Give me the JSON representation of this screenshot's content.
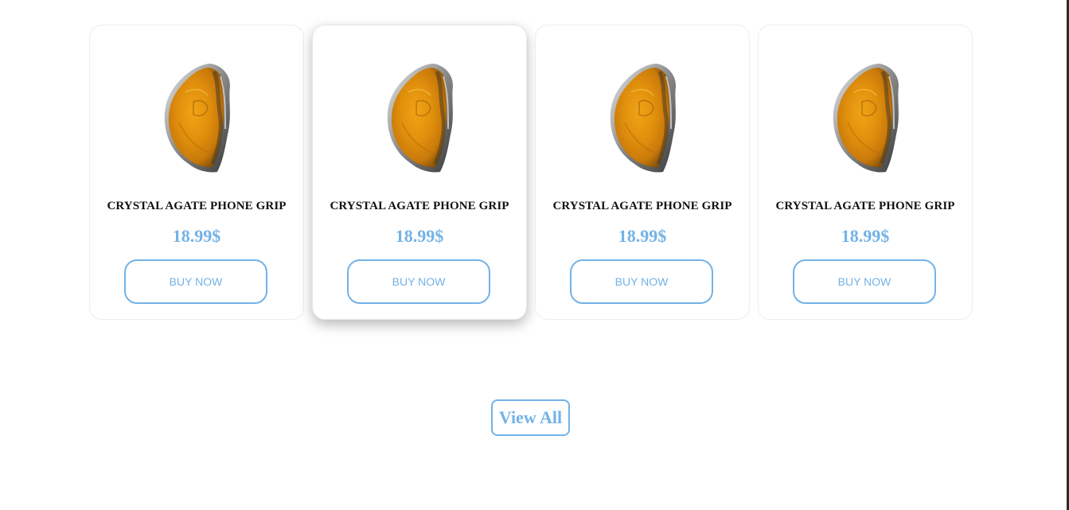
{
  "products": [
    {
      "title": "CRYSTAL AGATE PHONE GRIP",
      "price": "18.99$",
      "button_label": "BUY NOW",
      "image_icon": "agate-stone-image"
    },
    {
      "title": "CRYSTAL AGATE PHONE GRIP",
      "price": "18.99$",
      "button_label": "BUY NOW",
      "image_icon": "agate-stone-image"
    },
    {
      "title": "CRYSTAL AGATE PHONE GRIP",
      "price": "18.99$",
      "button_label": "BUY NOW",
      "image_icon": "agate-stone-image"
    },
    {
      "title": "CRYSTAL AGATE PHONE GRIP",
      "price": "18.99$",
      "button_label": "BUY NOW",
      "image_icon": "agate-stone-image"
    }
  ],
  "view_all_label": "View All",
  "colors": {
    "accent": "#73b2e6",
    "title_text": "#111111",
    "card_border": "#ededed",
    "agate_amber": "#e08f0c",
    "agate_rim": "#8a8a8a"
  }
}
